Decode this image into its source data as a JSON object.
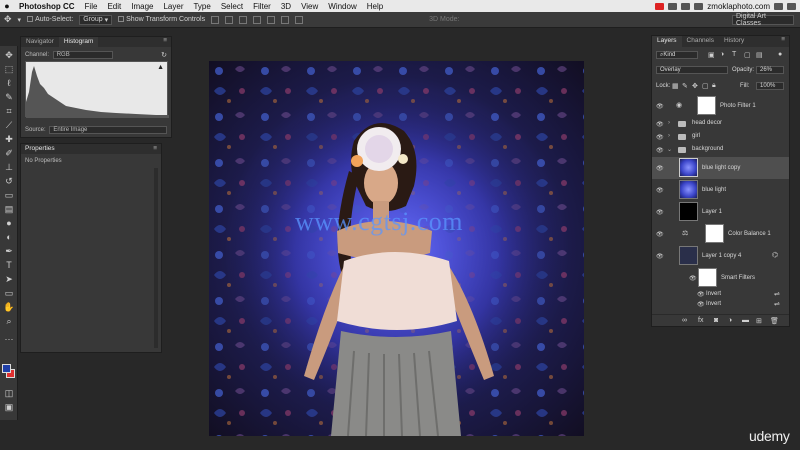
{
  "menubar": {
    "app": "Photoshop CC",
    "items": [
      "File",
      "Edit",
      "Image",
      "Layer",
      "Type",
      "Select",
      "Filter",
      "3D",
      "View",
      "Window",
      "Help"
    ],
    "site": "zmoklaphoto.com"
  },
  "options": {
    "auto_select_label": "Auto-Select:",
    "auto_select_value": "Group",
    "transform_controls_label": "Show Transform Controls",
    "mode_3d": "3D Mode:",
    "workspace": "Digital Art Classes"
  },
  "navigator_panel": {
    "tabs": [
      "Navigator",
      "Histogram"
    ],
    "active_tab": "Histogram",
    "channel_label": "Channel:",
    "channel_value": "RGB",
    "source_label": "Source:",
    "source_value": "Entire Image"
  },
  "properties_panel": {
    "title": "Properties",
    "body": "No Properties"
  },
  "canvas": {
    "watermark": "www.cgtsj.com"
  },
  "layers_panel": {
    "tabs": [
      "Layers",
      "Channels",
      "History"
    ],
    "active_tab": "Layers",
    "filter": "Kind",
    "blend_mode": "Overlay",
    "opacity_label": "Opacity:",
    "opacity_value": "26%",
    "lock_label": "Lock:",
    "fill_label": "Fill:",
    "fill_value": "100%",
    "layers": [
      {
        "name": "Photo Filter 1",
        "kind": "adjustment"
      },
      {
        "name": "head decor",
        "kind": "group"
      },
      {
        "name": "girl",
        "kind": "group"
      },
      {
        "name": "background",
        "kind": "group-open"
      },
      {
        "name": "blue light copy",
        "kind": "pixel",
        "selected": true
      },
      {
        "name": "blue light",
        "kind": "pixel"
      },
      {
        "name": "Layer 1",
        "kind": "pixel"
      },
      {
        "name": "Color Balance 1",
        "kind": "adjustment"
      },
      {
        "name": "Layer 1 copy 4",
        "kind": "smart"
      },
      {
        "name": "Smart Filters",
        "kind": "smart-filters"
      },
      {
        "name": "Invert",
        "kind": "filter"
      },
      {
        "name": "Invert",
        "kind": "filter"
      }
    ],
    "footer_icons": [
      "link-icon",
      "fx-icon",
      "mask-icon",
      "adjustment-icon",
      "folder-icon",
      "new-layer-icon",
      "trash-icon"
    ]
  },
  "branding": {
    "udemy": "udemy"
  },
  "colors": {
    "foreground": "#1f3fa8",
    "background": "#e03030"
  }
}
